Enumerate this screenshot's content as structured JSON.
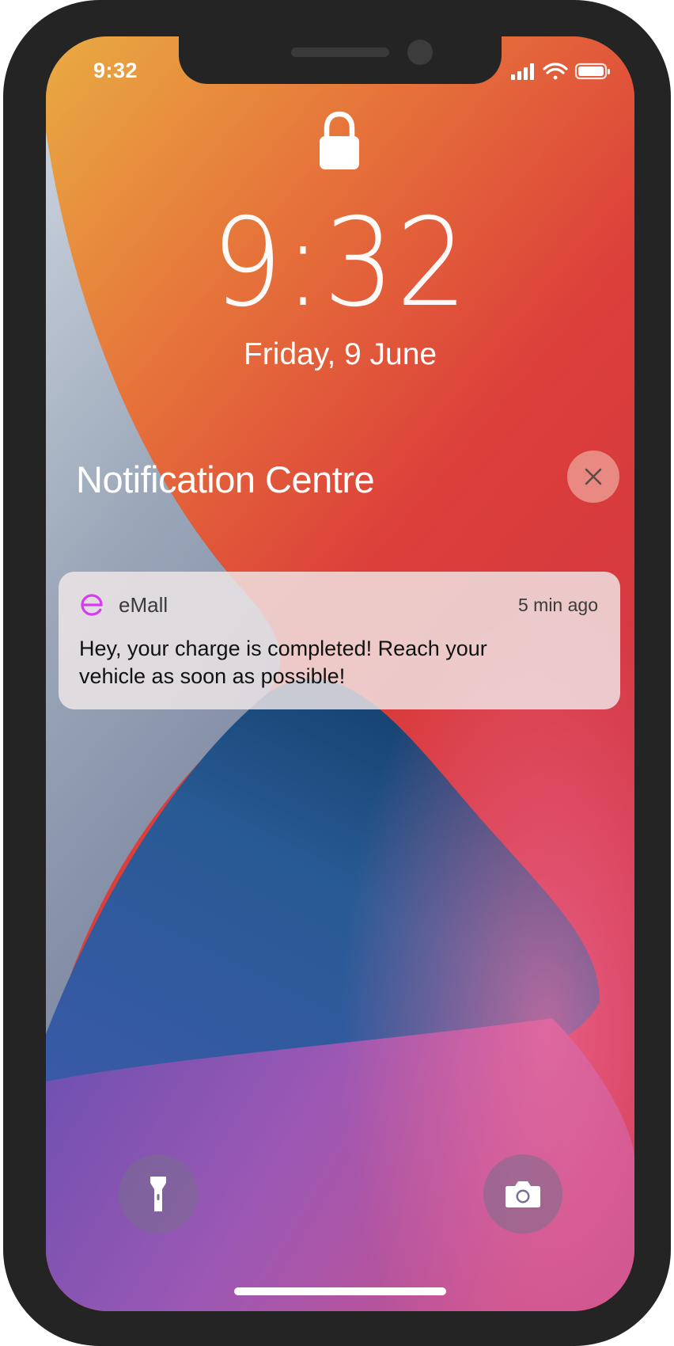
{
  "status_bar": {
    "time": "9:32",
    "icons": [
      "cellular-signal-icon",
      "wifi-icon",
      "battery-icon"
    ]
  },
  "lock_screen": {
    "lock_icon": "lock-icon",
    "clock": "9:32",
    "date": "Friday, 9 June"
  },
  "notification_centre": {
    "title": "Notification Centre",
    "close_icon": "close-icon"
  },
  "notification": {
    "app_name": "eMall",
    "app_icon": "emall-app-icon",
    "time_ago": "5 min ago",
    "message": "Hey, your charge is completed! Reach your vehicle as soon as possible!"
  },
  "quick_actions": {
    "left_icon": "flashlight-icon",
    "right_icon": "camera-icon"
  },
  "colors": {
    "phone_frame": "#242424",
    "app_accent": "#d63cf0",
    "wallpaper_orange": "#e8a040",
    "wallpaper_red": "#d8323e",
    "wallpaper_blue": "#1d4a7c",
    "wallpaper_purple": "#9058b8"
  }
}
